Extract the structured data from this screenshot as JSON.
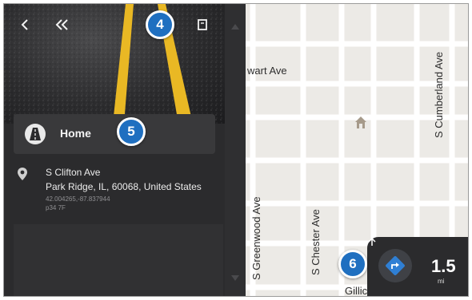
{
  "panel": {
    "home_label": "Home",
    "address_line1": "S Clifton Ave",
    "address_line2": "Park Ridge, IL, 60068, United States",
    "coordinates": "42.004265,-87.837944",
    "extra_code": "p34 7F"
  },
  "callouts": {
    "c4": "4",
    "c5": "5",
    "c6": "6"
  },
  "map": {
    "streets": {
      "stewart": "wart Ave",
      "cumberland": "S Cumberland Ave",
      "greenwood": "S Greenwood Ave",
      "chester": "S Chester Ave",
      "gillick": "Gillic"
    }
  },
  "navigation": {
    "distance": "1.5",
    "unit": "mi"
  },
  "colors": {
    "callout": "#1f6fc0",
    "nav_button": "#2f7fd4",
    "road_stripe": "#e9b824"
  }
}
